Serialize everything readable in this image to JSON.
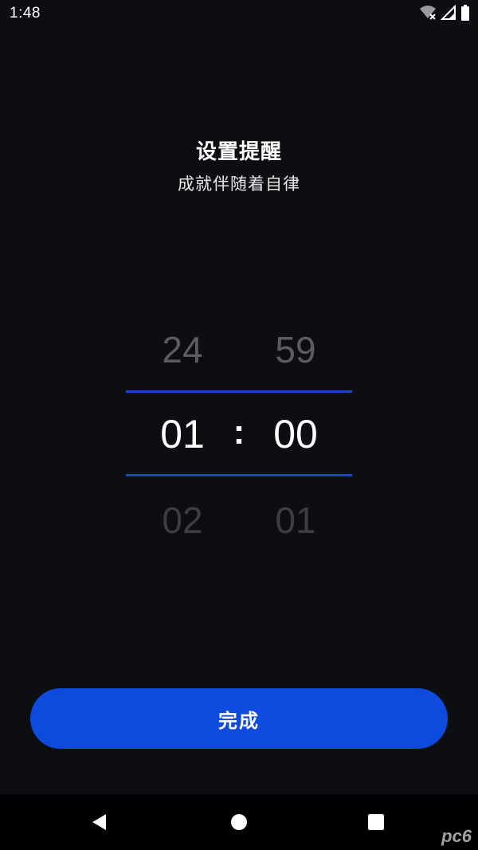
{
  "status_bar": {
    "time": "1:48",
    "icons": [
      "wifi-off-icon",
      "cell-signal-icon",
      "battery-icon"
    ]
  },
  "header": {
    "title": "设置提醒",
    "subtitle": "成就伴随着自律"
  },
  "time_picker": {
    "separator": ":",
    "hours": {
      "prev": "24",
      "current": "01",
      "next": "02"
    },
    "minutes": {
      "prev": "59",
      "current": "00",
      "next": "01"
    },
    "accent_color": "#1947c4"
  },
  "done_button": {
    "label": "完成",
    "color": "#0d4add"
  },
  "nav_bar": {
    "icons": [
      "back-icon",
      "home-icon",
      "recents-icon"
    ]
  },
  "watermark": {
    "text": "pc6"
  }
}
